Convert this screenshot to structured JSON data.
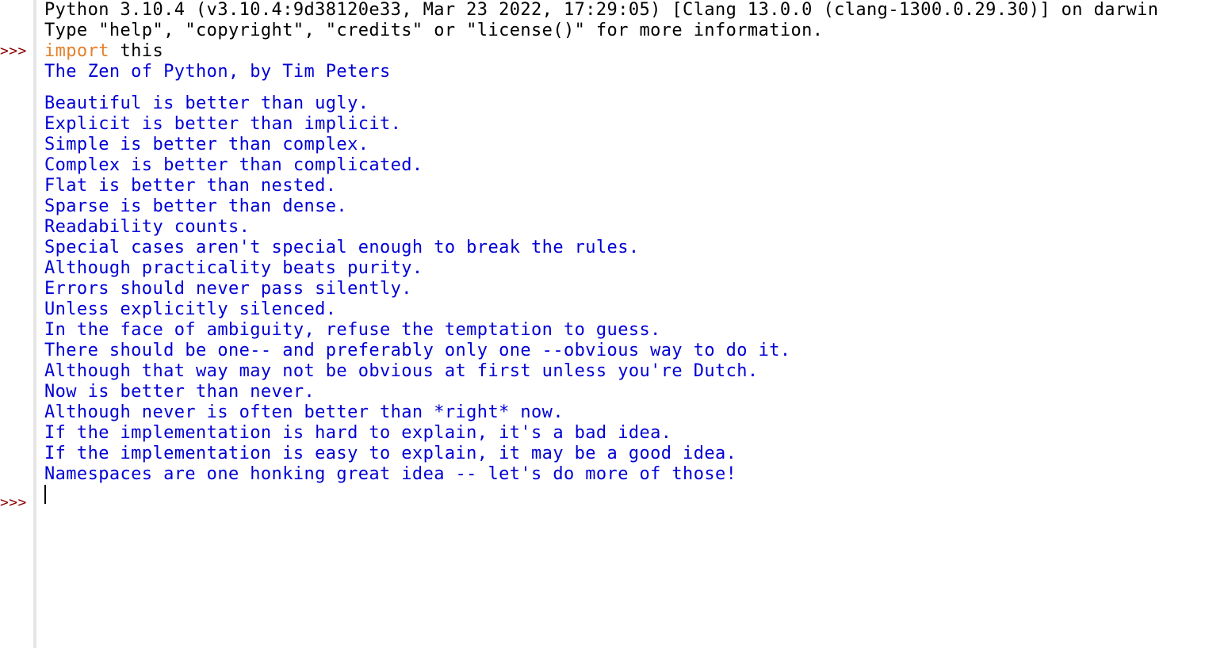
{
  "shell": {
    "banner_line_1": "Python 3.10.4 (v3.10.4:9d38120e33, Mar 23 2022, 17:29:05) [Clang 13.0.0 (clang-1300.0.29.30)] on darwin",
    "banner_line_2": "Type \"help\", \"copyright\", \"credits\" or \"license()\" for more information.",
    "prompt_symbol": ">>>",
    "command": {
      "keyword": "import",
      "rest": " this"
    },
    "output_title": "The Zen of Python, by Tim Peters",
    "zen_lines": [
      "Beautiful is better than ugly.",
      "Explicit is better than implicit.",
      "Simple is better than complex.",
      "Complex is better than complicated.",
      "Flat is better than nested.",
      "Sparse is better than dense.",
      "Readability counts.",
      "Special cases aren't special enough to break the rules.",
      "Although practicality beats purity.",
      "Errors should never pass silently.",
      "Unless explicitly silenced.",
      "In the face of ambiguity, refuse the temptation to guess.",
      "There should be one-- and preferably only one --obvious way to do it.",
      "Although that way may not be obvious at first unless you're Dutch.",
      "Now is better than never.",
      "Although never is often better than *right* now.",
      "If the implementation is hard to explain, it's a bad idea.",
      "If the implementation is easy to explain, it may be a good idea.",
      "Namespaces are one honking great idea -- let's do more of those!"
    ],
    "colors": {
      "prompt": "#8b0000",
      "stdout": "#000000",
      "output": "#0000d6",
      "keyword": "#e57f2a"
    }
  }
}
